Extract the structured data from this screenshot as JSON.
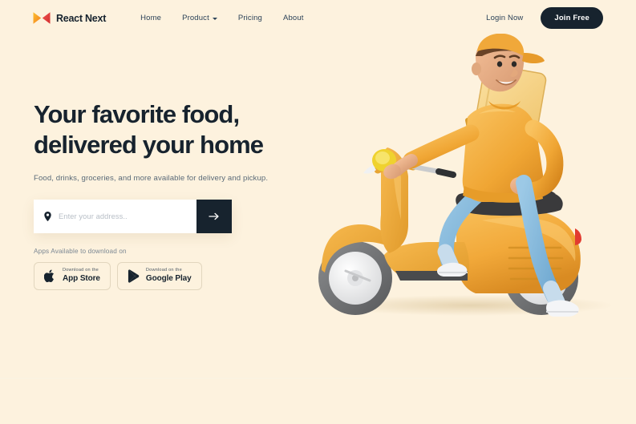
{
  "brand": {
    "name": "React Next",
    "logo_icon": "bowtie-logo-icon",
    "logo_gradient_from": "#F5A623",
    "logo_gradient_to": "#E53935"
  },
  "nav": {
    "links": [
      {
        "label": "Home",
        "has_dropdown": false
      },
      {
        "label": "Product",
        "has_dropdown": true
      },
      {
        "label": "Pricing",
        "has_dropdown": false
      },
      {
        "label": "About",
        "has_dropdown": false
      }
    ],
    "login_label": "Login Now",
    "cta_label": "Join Free"
  },
  "hero": {
    "headline_line1": "Your favorite food,",
    "headline_line2": "delivered your home",
    "subhead": "Food, drinks, groceries, and more available for delivery and pickup.",
    "search": {
      "pin_icon": "location-pin-icon",
      "placeholder": "Enter your address..",
      "value": "",
      "submit_icon": "arrow-right-icon"
    },
    "apps_label": "Apps Available to download on",
    "badges": [
      {
        "icon": "apple-logo-icon",
        "small": "Download on the",
        "big": "App Store"
      },
      {
        "icon": "google-play-icon",
        "small": "Download on the",
        "big": "Google Play"
      }
    ],
    "illustration_alt": "3d-delivery-courier-on-yellow-scooter"
  },
  "colors": {
    "page_background": "#FDF2DE",
    "ink": "#17232E",
    "muted_text": "#5A6A78",
    "scooter_yellow": "#F5AE3C",
    "jeans_blue": "#7FB7DE",
    "seat_dark": "#3A3A3C"
  }
}
